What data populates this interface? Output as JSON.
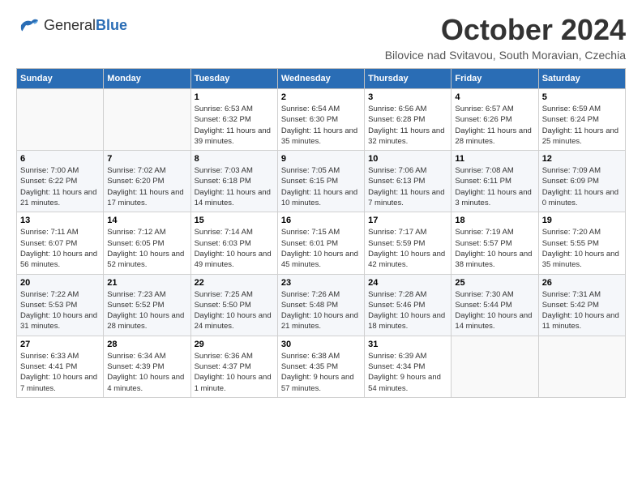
{
  "header": {
    "logo_general": "General",
    "logo_blue": "Blue",
    "month_title": "October 2024",
    "location": "Bilovice nad Svitavou, South Moravian, Czechia"
  },
  "weekdays": [
    "Sunday",
    "Monday",
    "Tuesday",
    "Wednesday",
    "Thursday",
    "Friday",
    "Saturday"
  ],
  "weeks": [
    [
      {
        "day": "",
        "info": ""
      },
      {
        "day": "",
        "info": ""
      },
      {
        "day": "1",
        "info": "Sunrise: 6:53 AM\nSunset: 6:32 PM\nDaylight: 11 hours and 39 minutes."
      },
      {
        "day": "2",
        "info": "Sunrise: 6:54 AM\nSunset: 6:30 PM\nDaylight: 11 hours and 35 minutes."
      },
      {
        "day": "3",
        "info": "Sunrise: 6:56 AM\nSunset: 6:28 PM\nDaylight: 11 hours and 32 minutes."
      },
      {
        "day": "4",
        "info": "Sunrise: 6:57 AM\nSunset: 6:26 PM\nDaylight: 11 hours and 28 minutes."
      },
      {
        "day": "5",
        "info": "Sunrise: 6:59 AM\nSunset: 6:24 PM\nDaylight: 11 hours and 25 minutes."
      }
    ],
    [
      {
        "day": "6",
        "info": "Sunrise: 7:00 AM\nSunset: 6:22 PM\nDaylight: 11 hours and 21 minutes."
      },
      {
        "day": "7",
        "info": "Sunrise: 7:02 AM\nSunset: 6:20 PM\nDaylight: 11 hours and 17 minutes."
      },
      {
        "day": "8",
        "info": "Sunrise: 7:03 AM\nSunset: 6:18 PM\nDaylight: 11 hours and 14 minutes."
      },
      {
        "day": "9",
        "info": "Sunrise: 7:05 AM\nSunset: 6:15 PM\nDaylight: 11 hours and 10 minutes."
      },
      {
        "day": "10",
        "info": "Sunrise: 7:06 AM\nSunset: 6:13 PM\nDaylight: 11 hours and 7 minutes."
      },
      {
        "day": "11",
        "info": "Sunrise: 7:08 AM\nSunset: 6:11 PM\nDaylight: 11 hours and 3 minutes."
      },
      {
        "day": "12",
        "info": "Sunrise: 7:09 AM\nSunset: 6:09 PM\nDaylight: 11 hours and 0 minutes."
      }
    ],
    [
      {
        "day": "13",
        "info": "Sunrise: 7:11 AM\nSunset: 6:07 PM\nDaylight: 10 hours and 56 minutes."
      },
      {
        "day": "14",
        "info": "Sunrise: 7:12 AM\nSunset: 6:05 PM\nDaylight: 10 hours and 52 minutes."
      },
      {
        "day": "15",
        "info": "Sunrise: 7:14 AM\nSunset: 6:03 PM\nDaylight: 10 hours and 49 minutes."
      },
      {
        "day": "16",
        "info": "Sunrise: 7:15 AM\nSunset: 6:01 PM\nDaylight: 10 hours and 45 minutes."
      },
      {
        "day": "17",
        "info": "Sunrise: 7:17 AM\nSunset: 5:59 PM\nDaylight: 10 hours and 42 minutes."
      },
      {
        "day": "18",
        "info": "Sunrise: 7:19 AM\nSunset: 5:57 PM\nDaylight: 10 hours and 38 minutes."
      },
      {
        "day": "19",
        "info": "Sunrise: 7:20 AM\nSunset: 5:55 PM\nDaylight: 10 hours and 35 minutes."
      }
    ],
    [
      {
        "day": "20",
        "info": "Sunrise: 7:22 AM\nSunset: 5:53 PM\nDaylight: 10 hours and 31 minutes."
      },
      {
        "day": "21",
        "info": "Sunrise: 7:23 AM\nSunset: 5:52 PM\nDaylight: 10 hours and 28 minutes."
      },
      {
        "day": "22",
        "info": "Sunrise: 7:25 AM\nSunset: 5:50 PM\nDaylight: 10 hours and 24 minutes."
      },
      {
        "day": "23",
        "info": "Sunrise: 7:26 AM\nSunset: 5:48 PM\nDaylight: 10 hours and 21 minutes."
      },
      {
        "day": "24",
        "info": "Sunrise: 7:28 AM\nSunset: 5:46 PM\nDaylight: 10 hours and 18 minutes."
      },
      {
        "day": "25",
        "info": "Sunrise: 7:30 AM\nSunset: 5:44 PM\nDaylight: 10 hours and 14 minutes."
      },
      {
        "day": "26",
        "info": "Sunrise: 7:31 AM\nSunset: 5:42 PM\nDaylight: 10 hours and 11 minutes."
      }
    ],
    [
      {
        "day": "27",
        "info": "Sunrise: 6:33 AM\nSunset: 4:41 PM\nDaylight: 10 hours and 7 minutes."
      },
      {
        "day": "28",
        "info": "Sunrise: 6:34 AM\nSunset: 4:39 PM\nDaylight: 10 hours and 4 minutes."
      },
      {
        "day": "29",
        "info": "Sunrise: 6:36 AM\nSunset: 4:37 PM\nDaylight: 10 hours and 1 minute."
      },
      {
        "day": "30",
        "info": "Sunrise: 6:38 AM\nSunset: 4:35 PM\nDaylight: 9 hours and 57 minutes."
      },
      {
        "day": "31",
        "info": "Sunrise: 6:39 AM\nSunset: 4:34 PM\nDaylight: 9 hours and 54 minutes."
      },
      {
        "day": "",
        "info": ""
      },
      {
        "day": "",
        "info": ""
      }
    ]
  ]
}
